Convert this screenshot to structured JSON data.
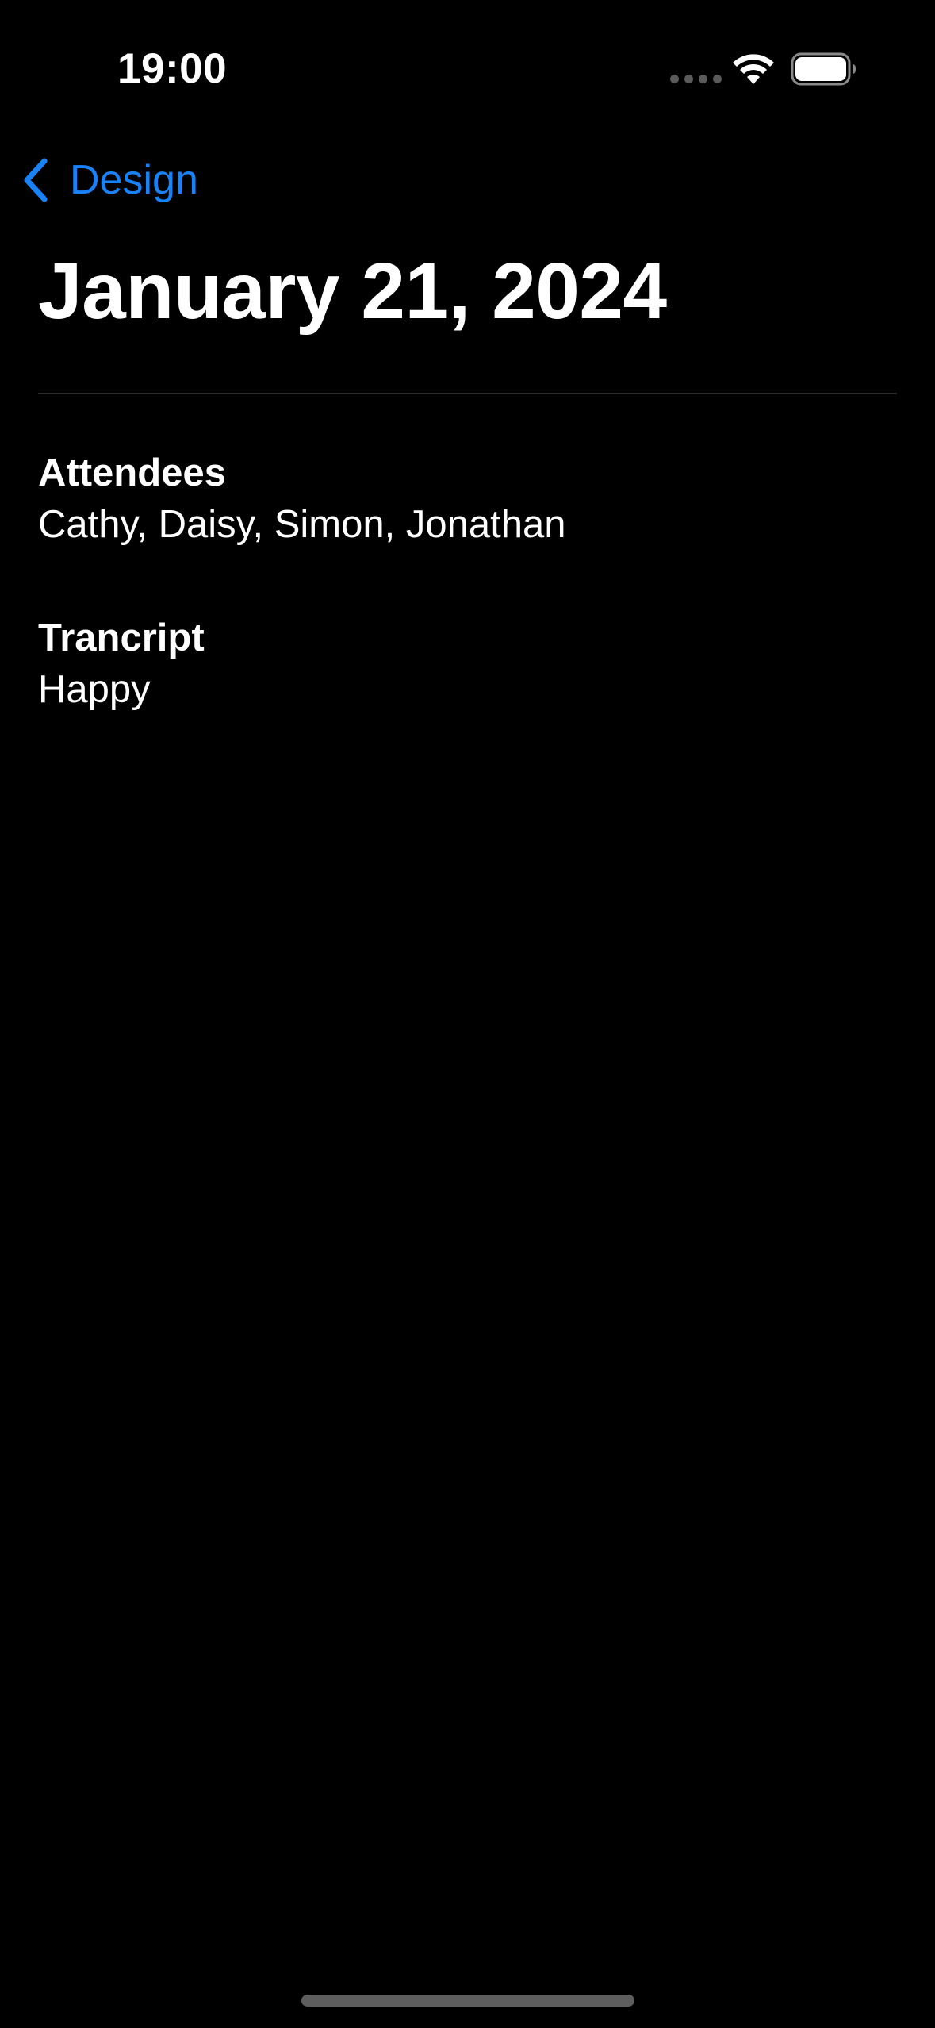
{
  "status_bar": {
    "time": "19:00",
    "icons": [
      "cellular-signal-icon",
      "wifi-icon",
      "battery-icon"
    ]
  },
  "nav": {
    "back_label": "Design",
    "back_icon": "chevron-left-icon",
    "accent_color": "#1a82f7"
  },
  "page": {
    "title": "January 21, 2024"
  },
  "sections": {
    "attendees": {
      "heading": "Attendees",
      "value": "Cathy, Daisy, Simon, Jonathan"
    },
    "transcript": {
      "heading": "Trancript",
      "value": "Happy"
    }
  },
  "theme": {
    "background": "#000000",
    "text": "#ffffff"
  }
}
